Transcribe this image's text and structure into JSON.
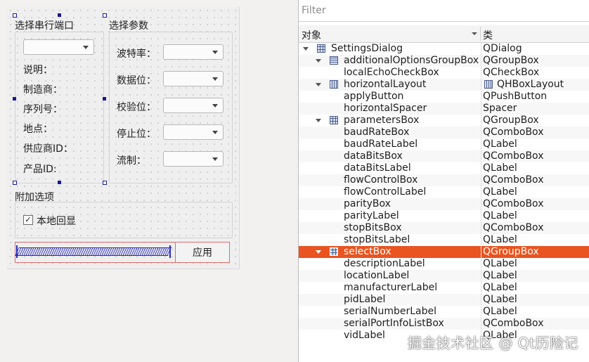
{
  "form": {
    "select_box": {
      "title": "选择串行端口",
      "combo_value": "",
      "labels": [
        "说明：",
        "制造商：",
        "序列号：",
        "地点：",
        "供应商ID：",
        "产品ID:"
      ]
    },
    "parameters_box": {
      "title": "选择参数",
      "fields": [
        {
          "label": "波特率：",
          "value": ""
        },
        {
          "label": "数据位：",
          "value": ""
        },
        {
          "label": "校验位：",
          "value": ""
        },
        {
          "label": "停止位：",
          "value": ""
        },
        {
          "label": "流制：",
          "value": ""
        }
      ]
    },
    "additional_options": {
      "title": "附加选项",
      "local_echo_label": "本地回显",
      "local_echo_checked": true,
      "check_glyph": "✓"
    },
    "apply_label": "应用"
  },
  "inspector": {
    "filter_placeholder": "Filter",
    "col_object": "对象",
    "col_class": "类",
    "rows": [
      {
        "name": "SettingsDialog",
        "cls": "QDialog",
        "icon": "grid-layout-icon"
      },
      {
        "name": "additionalOptionsGroupBox",
        "cls": "QGroupBox",
        "icon": "vbox-layout-icon"
      },
      {
        "name": "localEchoCheckBox",
        "cls": "QCheckBox",
        "icon": ""
      },
      {
        "name": "horizontalLayout",
        "cls": "QHBoxLayout",
        "icon": "hbox-layout-icon"
      },
      {
        "name": "applyButton",
        "cls": "QPushButton",
        "icon": ""
      },
      {
        "name": "horizontalSpacer",
        "cls": "Spacer",
        "icon": ""
      },
      {
        "name": "parametersBox",
        "cls": "QGroupBox",
        "icon": "grid-layout-icon"
      },
      {
        "name": "baudRateBox",
        "cls": "QComboBox",
        "icon": ""
      },
      {
        "name": "baudRateLabel",
        "cls": "QLabel",
        "icon": ""
      },
      {
        "name": "dataBitsBox",
        "cls": "QComboBox",
        "icon": ""
      },
      {
        "name": "dataBitsLabel",
        "cls": "QLabel",
        "icon": ""
      },
      {
        "name": "flowControlBox",
        "cls": "QComboBox",
        "icon": ""
      },
      {
        "name": "flowControlLabel",
        "cls": "QLabel",
        "icon": ""
      },
      {
        "name": "parityBox",
        "cls": "QComboBox",
        "icon": ""
      },
      {
        "name": "parityLabel",
        "cls": "QLabel",
        "icon": ""
      },
      {
        "name": "stopBitsBox",
        "cls": "QComboBox",
        "icon": ""
      },
      {
        "name": "stopBitsLabel",
        "cls": "QLabel",
        "icon": ""
      },
      {
        "name": "selectBox",
        "cls": "QGroupBox",
        "icon": "grid-layout-icon",
        "selected": true
      },
      {
        "name": "descriptionLabel",
        "cls": "QLabel",
        "icon": ""
      },
      {
        "name": "locationLabel",
        "cls": "QLabel",
        "icon": ""
      },
      {
        "name": "manufacturerLabel",
        "cls": "QLabel",
        "icon": ""
      },
      {
        "name": "pidLabel",
        "cls": "QLabel",
        "icon": ""
      },
      {
        "name": "serialNumberLabel",
        "cls": "QLabel",
        "icon": ""
      },
      {
        "name": "serialPortInfoListBox",
        "cls": "QComboBox",
        "icon": ""
      },
      {
        "name": "vidLabel",
        "cls": "QLabel",
        "icon": ""
      }
    ]
  },
  "watermark": "掘金技术社区 @ Qt历险记",
  "colors": {
    "selection": "#e95420",
    "layout_outline": "#e06c6c",
    "handle": "#1a1a8c"
  }
}
